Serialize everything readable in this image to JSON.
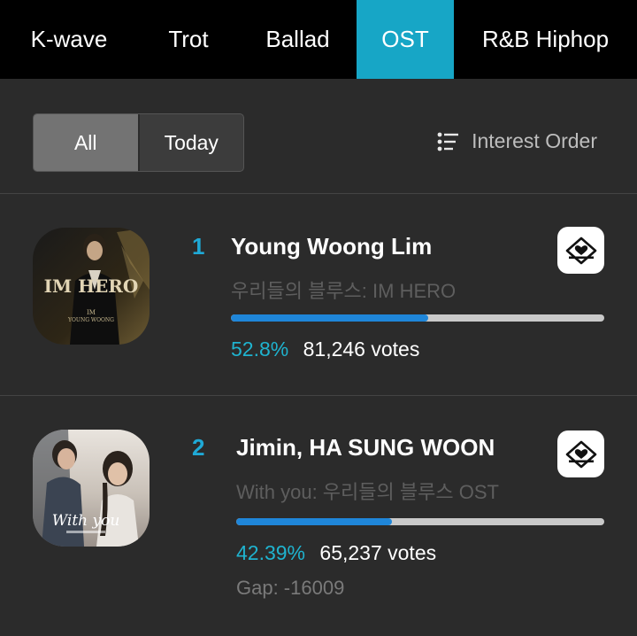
{
  "tabs": [
    {
      "label": "K-wave",
      "active": false
    },
    {
      "label": "Trot",
      "active": false
    },
    {
      "label": "Ballad",
      "active": false
    },
    {
      "label": "OST",
      "active": true
    },
    {
      "label": "R&B Hiphop",
      "active": false
    }
  ],
  "filter": {
    "segments": [
      "All",
      "Today"
    ],
    "selected": "All",
    "sort_label": "Interest Order",
    "sort_icon": "list-sort-icon"
  },
  "entries": [
    {
      "rank": "1",
      "artist": "Young Woong Lim",
      "song": "우리들의 블루스: IM HERO",
      "percent_label": "52.8%",
      "percent": 52.8,
      "votes": "81,246 votes",
      "gap": "",
      "cover_text": "IM HERO",
      "vote_icon": "heart-ballot-icon"
    },
    {
      "rank": "2",
      "artist": "Jimin, HA SUNG WOON",
      "song": "With you: 우리들의 블루스 OST",
      "percent_label": "42.39%",
      "percent": 42.39,
      "votes": "65,237 votes",
      "gap": "Gap: -16009",
      "cover_text": "With you",
      "vote_icon": "heart-ballot-icon"
    }
  ],
  "colors": {
    "accent": "#17a6c6",
    "percent": "#1fb3cf",
    "bar_fill": "#1f86d9",
    "background": "#2b2b2b"
  }
}
